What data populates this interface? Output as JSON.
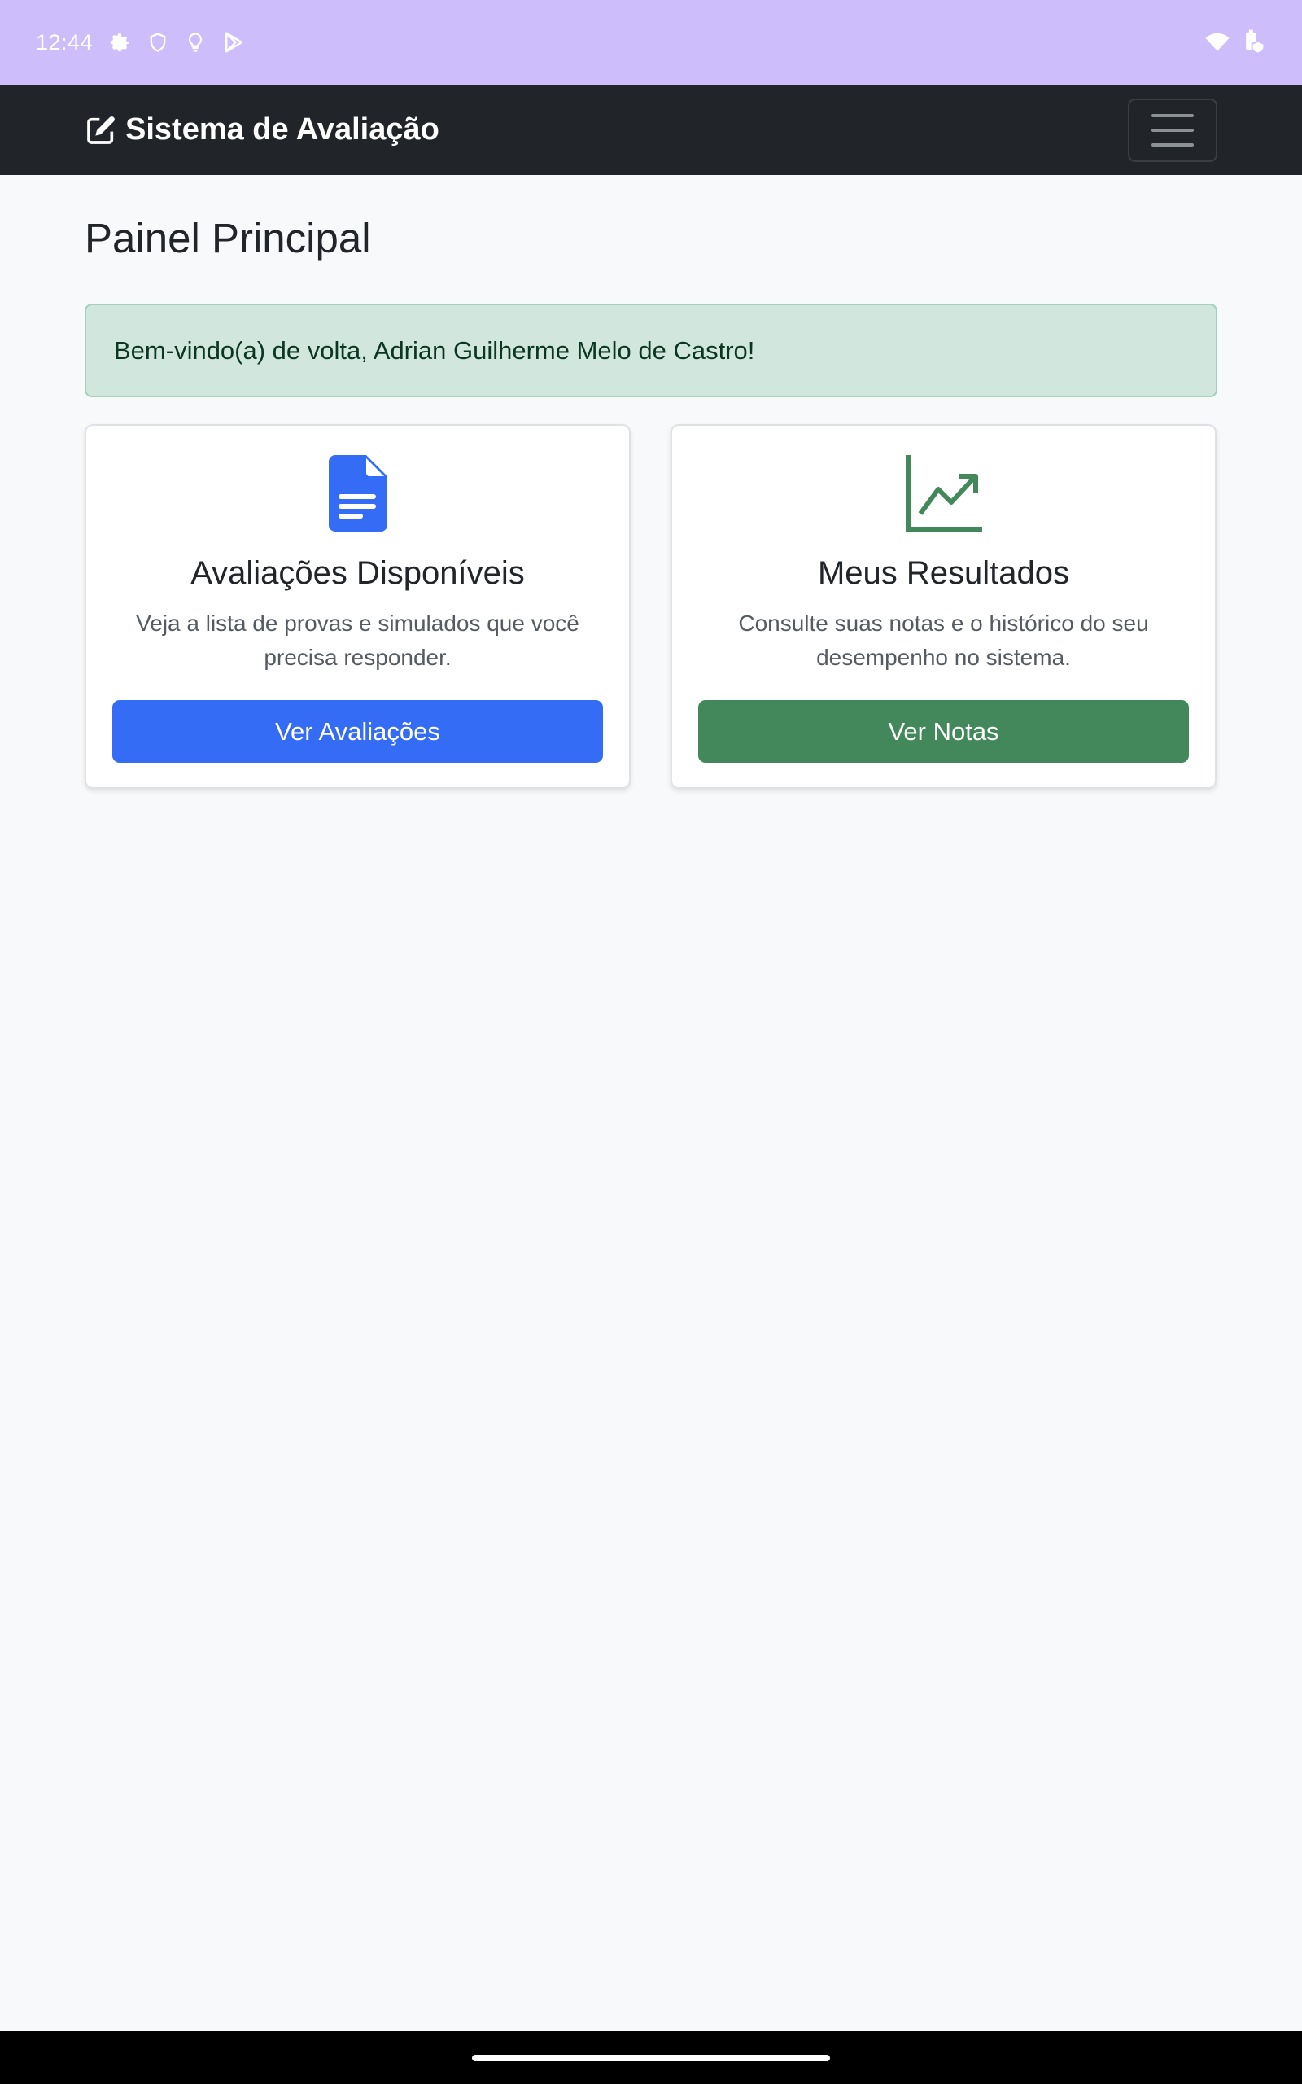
{
  "status_bar": {
    "time": "12:44",
    "icons_left": [
      "gear-icon",
      "shield-icon",
      "lightbulb-icon",
      "play-store-icon"
    ],
    "icons_right": [
      "wifi-icon",
      "battery-icon"
    ]
  },
  "navbar": {
    "brand_icon": "edit-icon",
    "brand": "Sistema de Avaliação",
    "toggler_icon": "menu-icon"
  },
  "main": {
    "title": "Painel Principal",
    "alert": "Bem-vindo(a) de volta, Adrian Guilherme Melo de Castro!",
    "cards": [
      {
        "icon": "document-icon",
        "title": "Avaliações Disponíveis",
        "text": "Veja a lista de provas e simulados que você precisa responder.",
        "button": "Ver Avaliações"
      },
      {
        "icon": "chart-line-icon",
        "title": "Meus Resultados",
        "text": "Consulte suas notas e o histórico do seu desempenho no sistema.",
        "button": "Ver Notas"
      }
    ]
  },
  "colors": {
    "status_bar": "#cdbdfa",
    "navbar": "#212529",
    "alert_bg": "#d1e7dd",
    "primary": "#356cf5",
    "success": "#42885a"
  }
}
